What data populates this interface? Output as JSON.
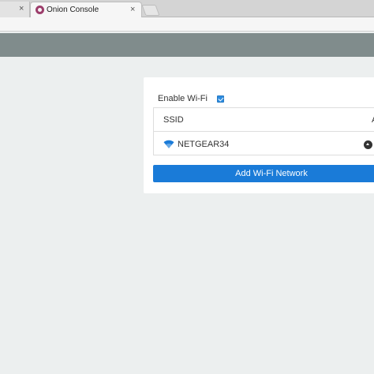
{
  "browser": {
    "inactive_tab_close": "×",
    "active_tab_title": "Onion Console",
    "active_tab_close": "×"
  },
  "wifi": {
    "enable_label": "Enable Wi-Fi",
    "enabled": true,
    "table": {
      "columns": [
        "SSID",
        "A"
      ],
      "rows": [
        {
          "ssid": "NETGEAR34"
        }
      ]
    },
    "add_button_label": "Add Wi-Fi Network"
  },
  "colors": {
    "header": "#808c8c",
    "background": "#ecefef",
    "accent": "#1a7bd8"
  },
  "icons": {
    "tab_favicon": "onion-logo-icon",
    "network": "wifi-icon",
    "row_action": "up-arrow-circle-icon"
  }
}
